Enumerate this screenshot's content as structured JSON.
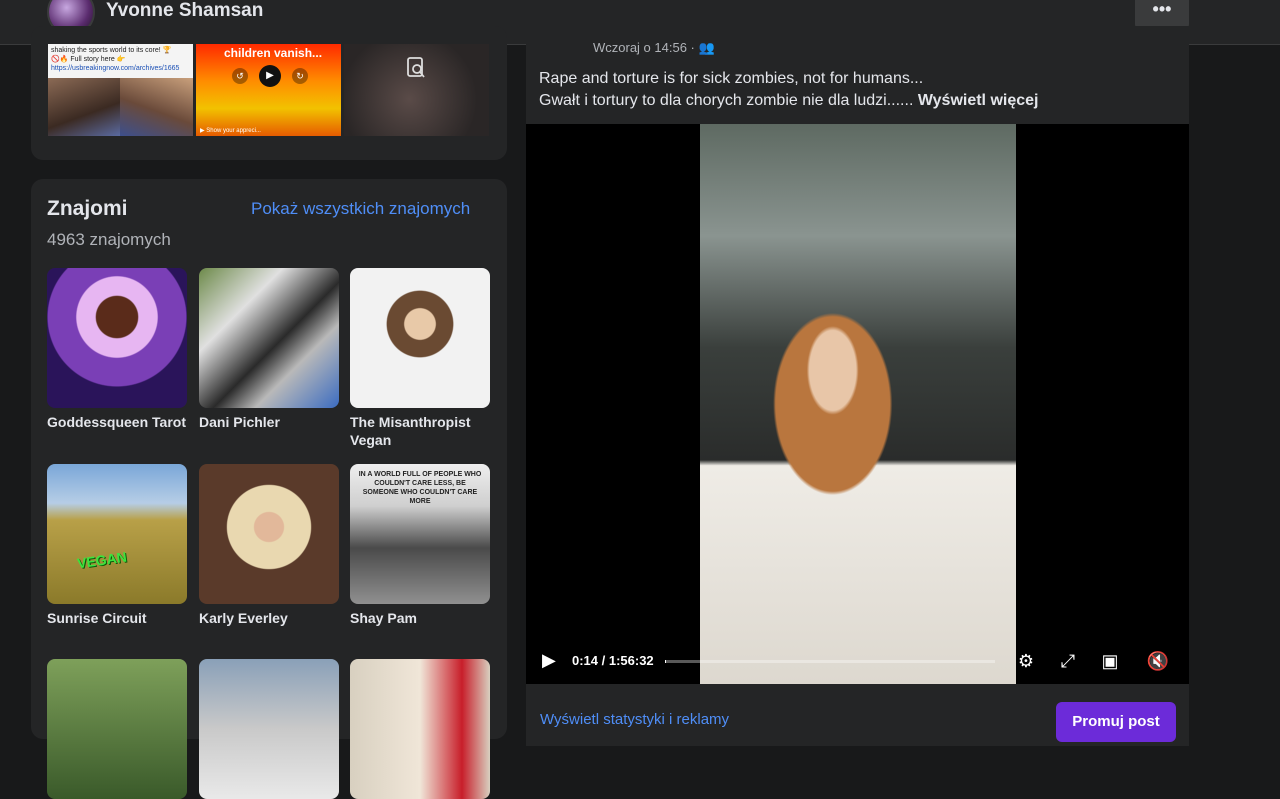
{
  "header": {
    "profile_name": "Yvonne Shamsan",
    "more_label": "•••"
  },
  "photos": {
    "tile1_text": "shaking the sports world to its core! 🏆",
    "tile1_text2": "🚫🔥 Full story here 👉",
    "tile1_link": "https://usbreakingnow.com/archives/1665",
    "tile2_caption": "children vanish...",
    "tile2_footer": "▶ Show your appreci...",
    "tile3_icon": "search-document-icon"
  },
  "friends": {
    "title": "Znajomi",
    "count_text": "4963 znajomych",
    "show_all": "Pokaż wszystkich znajomych",
    "items": [
      {
        "name": "Goddessqueen Tarot"
      },
      {
        "name": "Dani Pichler"
      },
      {
        "name": "The Misanthropist Vegan"
      },
      {
        "name": "Sunrise Circuit"
      },
      {
        "name": "Karly Everley"
      },
      {
        "name": "Shay Pam"
      },
      {
        "name": ""
      },
      {
        "name": ""
      },
      {
        "name": ""
      }
    ],
    "badge_vegan": "VEGAN",
    "quote": "IN A WORLD FULL OF PEOPLE WHO COULDN'T CARE LESS, BE SOMEONE WHO COULDN'T CARE MORE"
  },
  "post": {
    "timestamp": "Wczoraj o 14:56 · ",
    "line1": "Rape and torture is for sick zombies, not for humans...",
    "line2": "Gwałt i tortury to dla chorych zombie nie dla ludzi...... ",
    "see_more": "Wyświetl więcej",
    "video": {
      "time": "0:14 / 1:56:32",
      "progress": 0.002
    },
    "stats_link": "Wyświetl statystyki i reklamy",
    "promote_button": "Promuj post"
  }
}
